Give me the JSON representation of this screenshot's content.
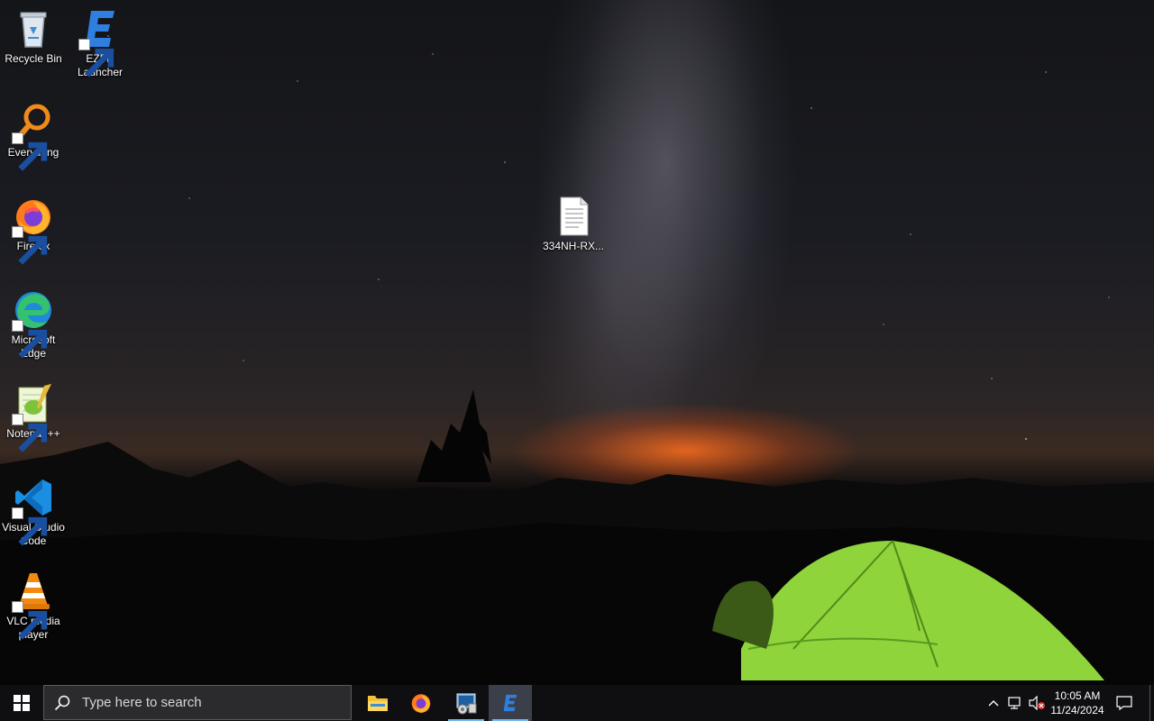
{
  "desktop": {
    "icons": [
      {
        "label": "Recycle Bin",
        "icon": "recycle-bin-icon",
        "shortcut": false
      },
      {
        "label": "EZFN Launcher",
        "icon": "ezfn-launcher-icon",
        "shortcut": true
      },
      {
        "label": "Everything",
        "icon": "everything-search-icon",
        "shortcut": true
      },
      {
        "label": "Firefox",
        "icon": "firefox-icon",
        "shortcut": true
      },
      {
        "label": "Microsoft Edge",
        "icon": "edge-icon",
        "shortcut": true
      },
      {
        "label": "Notepad++",
        "icon": "notepad-plus-plus-icon",
        "shortcut": true
      },
      {
        "label": "Visual Studio Code",
        "icon": "vscode-icon",
        "shortcut": true
      },
      {
        "label": "VLC media player",
        "icon": "vlc-icon",
        "shortcut": true
      },
      {
        "label": "334NH-RX...",
        "icon": "text-file-icon",
        "shortcut": false
      }
    ]
  },
  "taskbar": {
    "search_placeholder": "Type here to search",
    "pinned_apps": [
      {
        "name": "File Explorer",
        "icon": "file-explorer-icon"
      },
      {
        "name": "Firefox",
        "icon": "firefox-icon"
      },
      {
        "name": "Control Panel",
        "icon": "control-panel-icon"
      },
      {
        "name": "EZFN Launcher",
        "icon": "ezfn-launcher-icon",
        "active": true
      }
    ],
    "tray": {
      "time": "10:05 AM",
      "date": "11/24/2024"
    },
    "colors": {
      "taskbar_bg": "#0f0f12",
      "active_underline": "#76b9ed",
      "search_bg": "#2b2b2e"
    }
  }
}
